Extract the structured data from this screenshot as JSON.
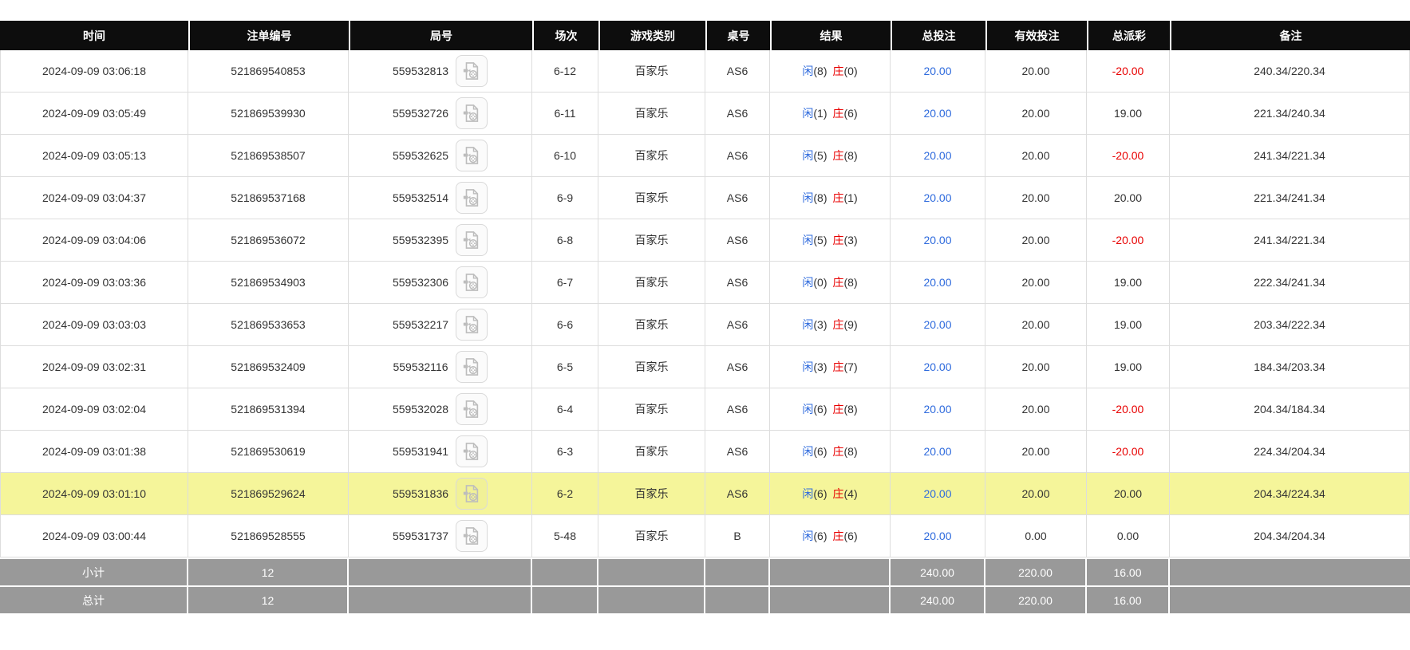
{
  "colors": {
    "header_bg": "#0d0d0d",
    "header_text": "#ffffff",
    "row_text": "#333333",
    "row_border": "#dddddd",
    "accent_blue": "#2f6bdd",
    "accent_red": "#e80000",
    "highlight_row_bg": "#f5f59a",
    "footer_bg": "#999999",
    "footer_text": "#ffffff"
  },
  "icons": {
    "round_cell_icon": "video-file-icon"
  },
  "table": {
    "columns": [
      {
        "key": "time",
        "label": "时间"
      },
      {
        "key": "bet_id",
        "label": "注单编号"
      },
      {
        "key": "round",
        "label": "局号"
      },
      {
        "key": "session",
        "label": "场次"
      },
      {
        "key": "game_type",
        "label": "游戏类别"
      },
      {
        "key": "table_no",
        "label": "桌号"
      },
      {
        "key": "result",
        "label": "结果"
      },
      {
        "key": "total_bet",
        "label": "总投注"
      },
      {
        "key": "valid_bet",
        "label": "有效投注"
      },
      {
        "key": "total_payout",
        "label": "总派彩"
      },
      {
        "key": "remark",
        "label": "备注"
      }
    ],
    "rows": [
      {
        "time": "2024-09-09 03:06:18",
        "bet_id": "521869540853",
        "round": "559532813",
        "session": "6-12",
        "game_type": "百家乐",
        "table_no": "AS6",
        "result_player": "闲",
        "result_player_points": "(8)",
        "result_banker": "庄",
        "result_banker_points": "(0)",
        "total_bet": "20.00",
        "valid_bet": "20.00",
        "total_payout": "-20.00",
        "remark": "240.34/220.34",
        "highlighted": false
      },
      {
        "time": "2024-09-09 03:05:49",
        "bet_id": "521869539930",
        "round": "559532726",
        "session": "6-11",
        "game_type": "百家乐",
        "table_no": "AS6",
        "result_player": "闲",
        "result_player_points": "(1)",
        "result_banker": "庄",
        "result_banker_points": "(6)",
        "total_bet": "20.00",
        "valid_bet": "20.00",
        "total_payout": "19.00",
        "remark": "221.34/240.34",
        "highlighted": false
      },
      {
        "time": "2024-09-09 03:05:13",
        "bet_id": "521869538507",
        "round": "559532625",
        "session": "6-10",
        "game_type": "百家乐",
        "table_no": "AS6",
        "result_player": "闲",
        "result_player_points": "(5)",
        "result_banker": "庄",
        "result_banker_points": "(8)",
        "total_bet": "20.00",
        "valid_bet": "20.00",
        "total_payout": "-20.00",
        "remark": "241.34/221.34",
        "highlighted": false
      },
      {
        "time": "2024-09-09 03:04:37",
        "bet_id": "521869537168",
        "round": "559532514",
        "session": "6-9",
        "game_type": "百家乐",
        "table_no": "AS6",
        "result_player": "闲",
        "result_player_points": "(8)",
        "result_banker": "庄",
        "result_banker_points": "(1)",
        "total_bet": "20.00",
        "valid_bet": "20.00",
        "total_payout": "20.00",
        "remark": "221.34/241.34",
        "highlighted": false
      },
      {
        "time": "2024-09-09 03:04:06",
        "bet_id": "521869536072",
        "round": "559532395",
        "session": "6-8",
        "game_type": "百家乐",
        "table_no": "AS6",
        "result_player": "闲",
        "result_player_points": "(5)",
        "result_banker": "庄",
        "result_banker_points": "(3)",
        "total_bet": "20.00",
        "valid_bet": "20.00",
        "total_payout": "-20.00",
        "remark": "241.34/221.34",
        "highlighted": false
      },
      {
        "time": "2024-09-09 03:03:36",
        "bet_id": "521869534903",
        "round": "559532306",
        "session": "6-7",
        "game_type": "百家乐",
        "table_no": "AS6",
        "result_player": "闲",
        "result_player_points": "(0)",
        "result_banker": "庄",
        "result_banker_points": "(8)",
        "total_bet": "20.00",
        "valid_bet": "20.00",
        "total_payout": "19.00",
        "remark": "222.34/241.34",
        "highlighted": false
      },
      {
        "time": "2024-09-09 03:03:03",
        "bet_id": "521869533653",
        "round": "559532217",
        "session": "6-6",
        "game_type": "百家乐",
        "table_no": "AS6",
        "result_player": "闲",
        "result_player_points": "(3)",
        "result_banker": "庄",
        "result_banker_points": "(9)",
        "total_bet": "20.00",
        "valid_bet": "20.00",
        "total_payout": "19.00",
        "remark": "203.34/222.34",
        "highlighted": false
      },
      {
        "time": "2024-09-09 03:02:31",
        "bet_id": "521869532409",
        "round": "559532116",
        "session": "6-5",
        "game_type": "百家乐",
        "table_no": "AS6",
        "result_player": "闲",
        "result_player_points": "(3)",
        "result_banker": "庄",
        "result_banker_points": "(7)",
        "total_bet": "20.00",
        "valid_bet": "20.00",
        "total_payout": "19.00",
        "remark": "184.34/203.34",
        "highlighted": false
      },
      {
        "time": "2024-09-09 03:02:04",
        "bet_id": "521869531394",
        "round": "559532028",
        "session": "6-4",
        "game_type": "百家乐",
        "table_no": "AS6",
        "result_player": "闲",
        "result_player_points": "(6)",
        "result_banker": "庄",
        "result_banker_points": "(8)",
        "total_bet": "20.00",
        "valid_bet": "20.00",
        "total_payout": "-20.00",
        "remark": "204.34/184.34",
        "highlighted": false
      },
      {
        "time": "2024-09-09 03:01:38",
        "bet_id": "521869530619",
        "round": "559531941",
        "session": "6-3",
        "game_type": "百家乐",
        "table_no": "AS6",
        "result_player": "闲",
        "result_player_points": "(6)",
        "result_banker": "庄",
        "result_banker_points": "(8)",
        "total_bet": "20.00",
        "valid_bet": "20.00",
        "total_payout": "-20.00",
        "remark": "224.34/204.34",
        "highlighted": false
      },
      {
        "time": "2024-09-09 03:01:10",
        "bet_id": "521869529624",
        "round": "559531836",
        "session": "6-2",
        "game_type": "百家乐",
        "table_no": "AS6",
        "result_player": "闲",
        "result_player_points": "(6)",
        "result_banker": "庄",
        "result_banker_points": "(4)",
        "total_bet": "20.00",
        "valid_bet": "20.00",
        "total_payout": "20.00",
        "remark": "204.34/224.34",
        "highlighted": true
      },
      {
        "time": "2024-09-09 03:00:44",
        "bet_id": "521869528555",
        "round": "559531737",
        "session": "5-48",
        "game_type": "百家乐",
        "table_no": "B",
        "result_player": "闲",
        "result_player_points": "(6)",
        "result_banker": "庄",
        "result_banker_points": "(6)",
        "total_bet": "20.00",
        "valid_bet": "0.00",
        "total_payout": "0.00",
        "remark": "204.34/204.34",
        "highlighted": false
      }
    ],
    "footer_rows": [
      {
        "label": "小计",
        "count": "12",
        "total_bet": "240.00",
        "valid_bet": "220.00",
        "total_payout": "16.00"
      },
      {
        "label": "总计",
        "count": "12",
        "total_bet": "240.00",
        "valid_bet": "220.00",
        "total_payout": "16.00"
      }
    ]
  }
}
